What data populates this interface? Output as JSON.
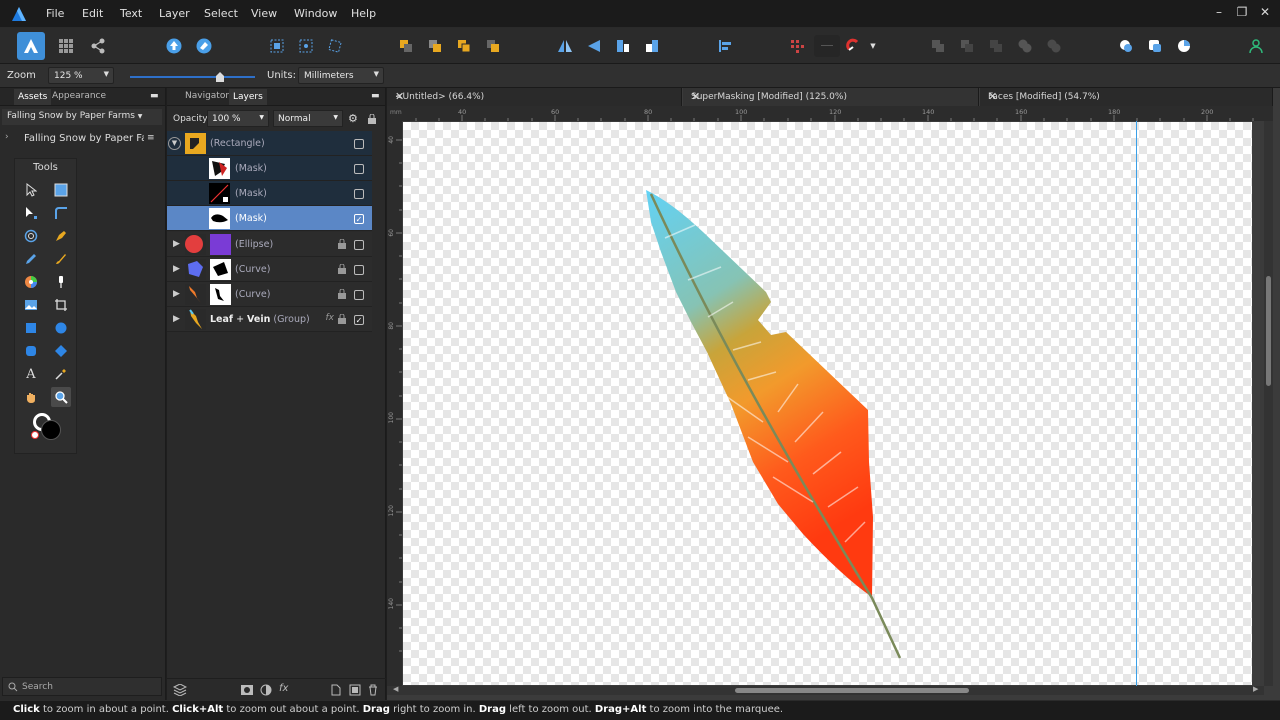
{
  "menu": [
    "File",
    "Edit",
    "Text",
    "Layer",
    "Select",
    "View",
    "Window",
    "Help"
  ],
  "window_controls": {
    "minimize": "–",
    "restore": "❐",
    "close": "✕"
  },
  "context_bar": {
    "zoom_label": "Zoom",
    "zoom_value": "125 %",
    "units_label": "Units:",
    "units_value": "Millimeters"
  },
  "left_panel": {
    "tabs": [
      "Assets",
      "Appearance"
    ],
    "category": "Falling Snow by Paper Farms",
    "item": "Falling Snow by Paper Farms",
    "tools_title": "Tools",
    "search_placeholder": "Search"
  },
  "layers_panel": {
    "tabs": [
      "Navigator",
      "Layers"
    ],
    "opacity_label": "Opacity:",
    "opacity_value": "100 %",
    "blend_mode": "Normal",
    "layers": [
      {
        "name": "(Rectangle)",
        "checked": false
      },
      {
        "name": "(Mask)",
        "checked": false
      },
      {
        "name": "(Mask)",
        "checked": false
      },
      {
        "name": "(Mask)",
        "checked": true
      },
      {
        "name": "(Ellipse)",
        "checked": false
      },
      {
        "name": "(Curve)",
        "checked": false
      },
      {
        "name": "(Curve)",
        "checked": false
      },
      {
        "name_bold": "Leaf",
        "plus": " + ",
        "name_bold2": "Vein",
        "name_rest": " (Group)",
        "checked": true
      }
    ]
  },
  "doc_tabs": [
    {
      "label": "<Untitled> (66.4%)",
      "close": "✕"
    },
    {
      "label": "SuperMasking [Modified] (125.0%)",
      "close": "✕"
    },
    {
      "label": "Faces [Modified] (54.7%)",
      "close": "✕"
    }
  ],
  "ruler": {
    "unit": "mm",
    "top_ticks": [
      "40",
      "60",
      "80",
      "100",
      "120",
      "140",
      "160",
      "180",
      "200"
    ],
    "left_ticks": [
      "40",
      "60",
      "80",
      "100",
      "120",
      "140"
    ]
  },
  "status": {
    "parts": [
      {
        "b": "Click"
      },
      {
        "t": " to zoom in about a point. "
      },
      {
        "b": "Click+Alt"
      },
      {
        "t": " to zoom out about a point. "
      },
      {
        "b": "Drag"
      },
      {
        "t": " right to zoom in. "
      },
      {
        "b": "Drag"
      },
      {
        "t": " left to zoom out. "
      },
      {
        "b": "Drag+Alt"
      },
      {
        "t": " to zoom into the marquee."
      }
    ]
  },
  "colors": {
    "accent": "#5b87c6",
    "guide": "#3aa0e8",
    "toolbar_blue": "#3f8fd8"
  }
}
